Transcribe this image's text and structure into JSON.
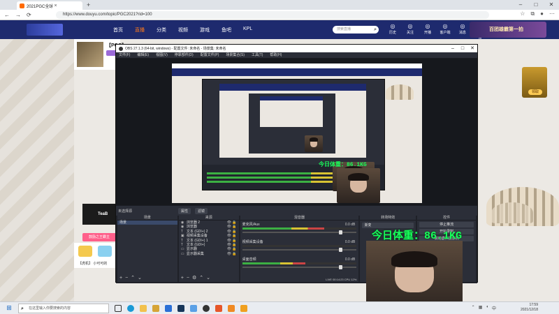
{
  "browser": {
    "tab_title": "2021PGC全球总决赛",
    "url": "https://www.douyu.com/topic/PGC2021?rid=100"
  },
  "douyu": {
    "nav": [
      "首页",
      "直播",
      "分类",
      "视频",
      "游戏",
      "鱼吧",
      "KPL"
    ],
    "search_placeholder": "搜索直播",
    "icons": [
      {
        "label": "历史",
        "icon": "history-icon"
      },
      {
        "label": "关注",
        "icon": "heart-icon"
      },
      {
        "label": "开播",
        "icon": "camera-icon"
      },
      {
        "label": "客户端",
        "icon": "download-icon"
      },
      {
        "label": "消息",
        "icon": "bell-icon"
      },
      {
        "label": "锦绣直播",
        "icon": "gift-icon"
      }
    ],
    "promo": "百团雄霸第一拍",
    "room_title": "【PGC】",
    "tea_label": "TeaB",
    "pink_button": "鼓励之王霸主",
    "chat_line": "【虎机】 小可可的",
    "side_ad_label": "领取"
  },
  "obs": {
    "title": "OBS 27.1.3 (64-bit, windows) - 配置文件: 未命名 - 场景集: 未命名",
    "menu": [
      "文件(F)",
      "编辑(E)",
      "视图(V)",
      "停靠部件(D)",
      "配置文件(P)",
      "场景集合(S)",
      "工具(T)",
      "帮助(H)"
    ],
    "source_bar": {
      "no_source": "未选择源",
      "props": "属性",
      "filters": "滤镜"
    },
    "docks": {
      "scenes": {
        "header": "场景",
        "items": [
          "场景"
        ]
      },
      "sources": {
        "header": "来源",
        "items": [
          {
            "name": "浏览器 2",
            "icon": "globe-icon"
          },
          {
            "name": "浏览器",
            "icon": "globe-icon"
          },
          {
            "name": "文本 (GDI+) 2",
            "icon": "text-icon"
          },
          {
            "name": "视频采集设备",
            "icon": "camera-icon"
          },
          {
            "name": "文本 (GDI+) 1",
            "icon": "text-icon"
          },
          {
            "name": "文本 (GDI+)",
            "icon": "text-icon"
          },
          {
            "name": "显示器",
            "icon": "monitor-icon"
          },
          {
            "name": "显示器采集",
            "icon": "monitor-icon"
          }
        ]
      },
      "mixer": {
        "header": "混音器",
        "channels": [
          {
            "name": "麦克风/Aux",
            "db": "0.0 dB",
            "level": 0.72
          },
          {
            "name": "视频采集设备",
            "db": "0.0 dB",
            "level": 0.0
          },
          {
            "name": "桌面音频",
            "db": "0.0 dB",
            "level": 0.55
          }
        ]
      },
      "transitions": {
        "header": "转场特效",
        "value": "渐变"
      },
      "controls": {
        "header": "控件",
        "buttons": [
          "停止推流",
          "开始录制",
          "启动虚拟摄像机"
        ]
      }
    },
    "status": "LIVE 00:14:23  CPU 12%"
  },
  "overlay_text": "今日体重：86.1KG",
  "overlay_text_small": "今日体重：86.1KG",
  "taskbar": {
    "search": "在这里输入你要搜索的内容",
    "time": "17:59",
    "date": "2021/12/18"
  }
}
